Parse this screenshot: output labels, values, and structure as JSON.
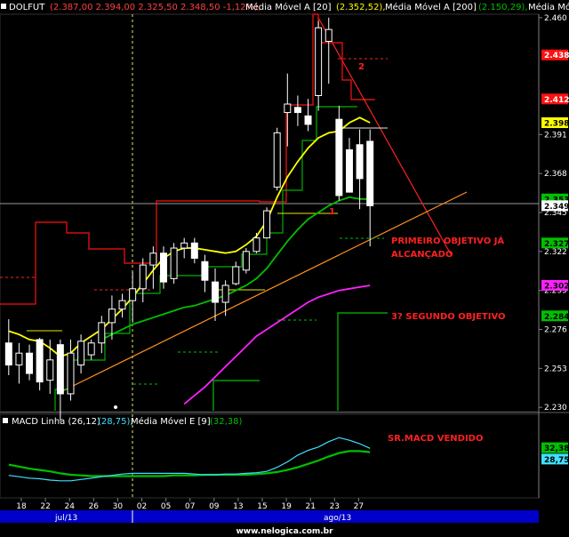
{
  "header": {
    "symbol": "DOLFUT",
    "ohlc": "(2.387,00  2.394,00  2.325,50  2.348,50  -1,12%),",
    "ma20_label": "Média Móvel A [20]",
    "ma20_value": "(2.352,52),",
    "ma200_label": "Média Móvel A [200]",
    "ma200_value": "(2.150,29),",
    "ma_last_label": "Média Móvel A"
  },
  "macd_header": {
    "line_label": "MACD Linha (26,12)",
    "line_value": "(28,75),",
    "signal_label": "Média Móvel E [9]",
    "signal_value": "(32,38)"
  },
  "annotations": {
    "label_1": "1",
    "label_2": "2",
    "first_objective_l1": "PRIMEIRO OBJETIVO JÁ",
    "first_objective_l2": "ALCANÇADO",
    "second_objective": "3? SEGUNDO OBJETIVO",
    "macd_note": "SR.MACD VENDIDO"
  },
  "price_tags": [
    {
      "text": "2.438",
      "bg": "#ff1010",
      "fg": "#ffffff",
      "price": 2.438
    },
    {
      "text": "2.412",
      "bg": "#ff1010",
      "fg": "#ffffff",
      "price": 2.412
    },
    {
      "text": "2.398",
      "bg": "#ffff00",
      "fg": "#000000",
      "price": 2.398
    },
    {
      "text": "2.353",
      "bg": "#00c000",
      "fg": "#000000",
      "price": 2.353
    },
    {
      "text": "2.349",
      "bg": "#ffffff",
      "fg": "#000000",
      "price": 2.349
    },
    {
      "text": "2.327",
      "bg": "#00c000",
      "fg": "#000000",
      "price": 2.327
    },
    {
      "text": "2.302",
      "bg": "#ff20ff",
      "fg": "#000000",
      "price": 2.302
    },
    {
      "text": "2.284",
      "bg": "#00c000",
      "fg": "#000000",
      "price": 2.284
    }
  ],
  "macd_tags": [
    {
      "text": "32,38",
      "bg": "#00c000",
      "fg": "#000000",
      "value": 32.38
    },
    {
      "text": "28,75",
      "bg": "#40e0ff",
      "fg": "#000000",
      "value": 28.75
    }
  ],
  "footer": {
    "month_left": "jul/13",
    "month_right": "ago/13",
    "website": "www.nelogica.com.br"
  },
  "chart_data": {
    "type": "candlestick",
    "title": "DOLFUT",
    "y_ticks": [
      2.46,
      2.391,
      2.368,
      2.345,
      2.322,
      2.299,
      2.276,
      2.253,
      2.23
    ],
    "ylim": [
      2.228,
      2.462
    ],
    "x_ticks": [
      "18",
      "22",
      "24",
      "26",
      "30",
      "02",
      "05",
      "07",
      "09",
      "13",
      "15",
      "19",
      "21",
      "23",
      "27"
    ],
    "candles": [
      {
        "o": 2.268,
        "h": 2.282,
        "l": 2.249,
        "c": 2.255
      },
      {
        "o": 2.255,
        "h": 2.268,
        "l": 2.244,
        "c": 2.262
      },
      {
        "o": 2.262,
        "h": 2.267,
        "l": 2.246,
        "c": 2.25
      },
      {
        "o": 2.27,
        "h": 2.271,
        "l": 2.24,
        "c": 2.245
      },
      {
        "o": 2.246,
        "h": 2.27,
        "l": 2.238,
        "c": 2.258
      },
      {
        "o": 2.267,
        "h": 2.27,
        "l": 2.222,
        "c": 2.238
      },
      {
        "o": 2.238,
        "h": 2.27,
        "l": 2.234,
        "c": 2.262
      },
      {
        "o": 2.255,
        "h": 2.273,
        "l": 2.25,
        "c": 2.269
      },
      {
        "o": 2.261,
        "h": 2.27,
        "l": 2.258,
        "c": 2.268
      },
      {
        "o": 2.268,
        "h": 2.284,
        "l": 2.262,
        "c": 2.28
      },
      {
        "o": 2.28,
        "h": 2.296,
        "l": 2.27,
        "c": 2.288
      },
      {
        "o": 2.288,
        "h": 2.297,
        "l": 2.283,
        "c": 2.293
      },
      {
        "o": 2.293,
        "h": 2.31,
        "l": 2.28,
        "c": 2.3
      },
      {
        "o": 2.3,
        "h": 2.318,
        "l": 2.292,
        "c": 2.314
      },
      {
        "o": 2.314,
        "h": 2.325,
        "l": 2.3,
        "c": 2.321
      },
      {
        "o": 2.321,
        "h": 2.325,
        "l": 2.3,
        "c": 2.304
      },
      {
        "o": 2.306,
        "h": 2.327,
        "l": 2.303,
        "c": 2.324
      },
      {
        "o": 2.324,
        "h": 2.33,
        "l": 2.318,
        "c": 2.327
      },
      {
        "o": 2.327,
        "h": 2.33,
        "l": 2.315,
        "c": 2.318
      },
      {
        "o": 2.316,
        "h": 2.32,
        "l": 2.298,
        "c": 2.305
      },
      {
        "o": 2.304,
        "h": 2.312,
        "l": 2.281,
        "c": 2.292
      },
      {
        "o": 2.292,
        "h": 2.305,
        "l": 2.284,
        "c": 2.302
      },
      {
        "o": 2.303,
        "h": 2.316,
        "l": 2.302,
        "c": 2.313
      },
      {
        "o": 2.311,
        "h": 2.324,
        "l": 2.309,
        "c": 2.322
      },
      {
        "o": 2.322,
        "h": 2.333,
        "l": 2.321,
        "c": 2.33
      },
      {
        "o": 2.33,
        "h": 2.348,
        "l": 2.33,
        "c": 2.346
      },
      {
        "o": 2.36,
        "h": 2.395,
        "l": 2.358,
        "c": 2.392
      },
      {
        "o": 2.404,
        "h": 2.427,
        "l": 2.384,
        "c": 2.409
      },
      {
        "o": 2.407,
        "h": 2.414,
        "l": 2.396,
        "c": 2.404
      },
      {
        "o": 2.402,
        "h": 2.412,
        "l": 2.393,
        "c": 2.397
      },
      {
        "o": 2.414,
        "h": 2.458,
        "l": 2.405,
        "c": 2.454
      },
      {
        "o": 2.446,
        "h": 2.46,
        "l": 2.421,
        "c": 2.453
      },
      {
        "o": 2.4,
        "h": 2.408,
        "l": 2.352,
        "c": 2.355
      },
      {
        "o": 2.382,
        "h": 2.389,
        "l": 2.364,
        "c": 2.357
      },
      {
        "o": 2.385,
        "h": 2.394,
        "l": 2.347,
        "c": 2.365
      },
      {
        "o": 2.387,
        "h": 2.394,
        "l": 2.325,
        "c": 2.349
      }
    ],
    "series": [
      {
        "name": "Média Móvel A [20]",
        "color": "#ffff00",
        "values": [
          2.275,
          2.273,
          2.27,
          2.269,
          2.265,
          2.26,
          2.262,
          2.268,
          2.272,
          2.276,
          2.282,
          2.288,
          2.295,
          2.303,
          2.311,
          2.318,
          2.322,
          2.324,
          2.324,
          2.323,
          2.322,
          2.321,
          2.322,
          2.326,
          2.331,
          2.34,
          2.354,
          2.366,
          2.375,
          2.383,
          2.389,
          2.392,
          2.393,
          2.398,
          2.401,
          2.398
        ]
      },
      {
        "name": "Média Móvel A [200]",
        "color": "#00c000",
        "values": [
          null,
          null,
          null,
          null,
          null,
          null,
          null,
          null,
          null,
          2.27,
          2.273,
          2.276,
          2.279,
          2.281,
          2.283,
          2.285,
          2.287,
          2.289,
          2.29,
          2.292,
          2.294,
          2.296,
          2.299,
          2.302,
          2.306,
          2.312,
          2.32,
          2.328,
          2.335,
          2.341,
          2.345,
          2.349,
          2.352,
          2.354,
          2.353,
          2.353
        ]
      },
      {
        "name": "Média Móvel A",
        "color": "#ff20ff",
        "values": [
          null,
          null,
          null,
          null,
          null,
          null,
          null,
          null,
          null,
          null,
          null,
          null,
          null,
          null,
          null,
          null,
          null,
          2.232,
          2.237,
          2.242,
          2.248,
          2.254,
          2.26,
          2.266,
          2.272,
          2.276,
          2.28,
          2.284,
          2.288,
          2.292,
          2.295,
          2.297,
          2.299,
          2.3,
          2.301,
          2.302
        ]
      }
    ],
    "macd": {
      "ylim": [
        -30,
        70
      ],
      "line": {
        "name": "MACD Linha (26,12)",
        "color": "#40e0ff",
        "values": [
          -2,
          -4,
          -6,
          -7,
          -9,
          -10,
          -10,
          -8,
          -6,
          -4,
          -2,
          0,
          1,
          1,
          1,
          1,
          1,
          1,
          0,
          -1,
          -1,
          0,
          0,
          1,
          2,
          4,
          10,
          18,
          28,
          35,
          40,
          48,
          54,
          50,
          45,
          38
        ]
      },
      "signal": {
        "name": "Média Móvel E [9]",
        "color": "#00c000",
        "values": [
          14,
          11,
          8,
          6,
          4,
          1,
          -1,
          -2,
          -3,
          -3,
          -3,
          -3,
          -3,
          -3,
          -3,
          -3,
          -2,
          -2,
          -2,
          -1,
          -1,
          -1,
          -1,
          -1,
          0,
          1,
          3,
          6,
          10,
          15,
          20,
          26,
          31,
          34,
          34,
          32.38
        ]
      }
    }
  }
}
